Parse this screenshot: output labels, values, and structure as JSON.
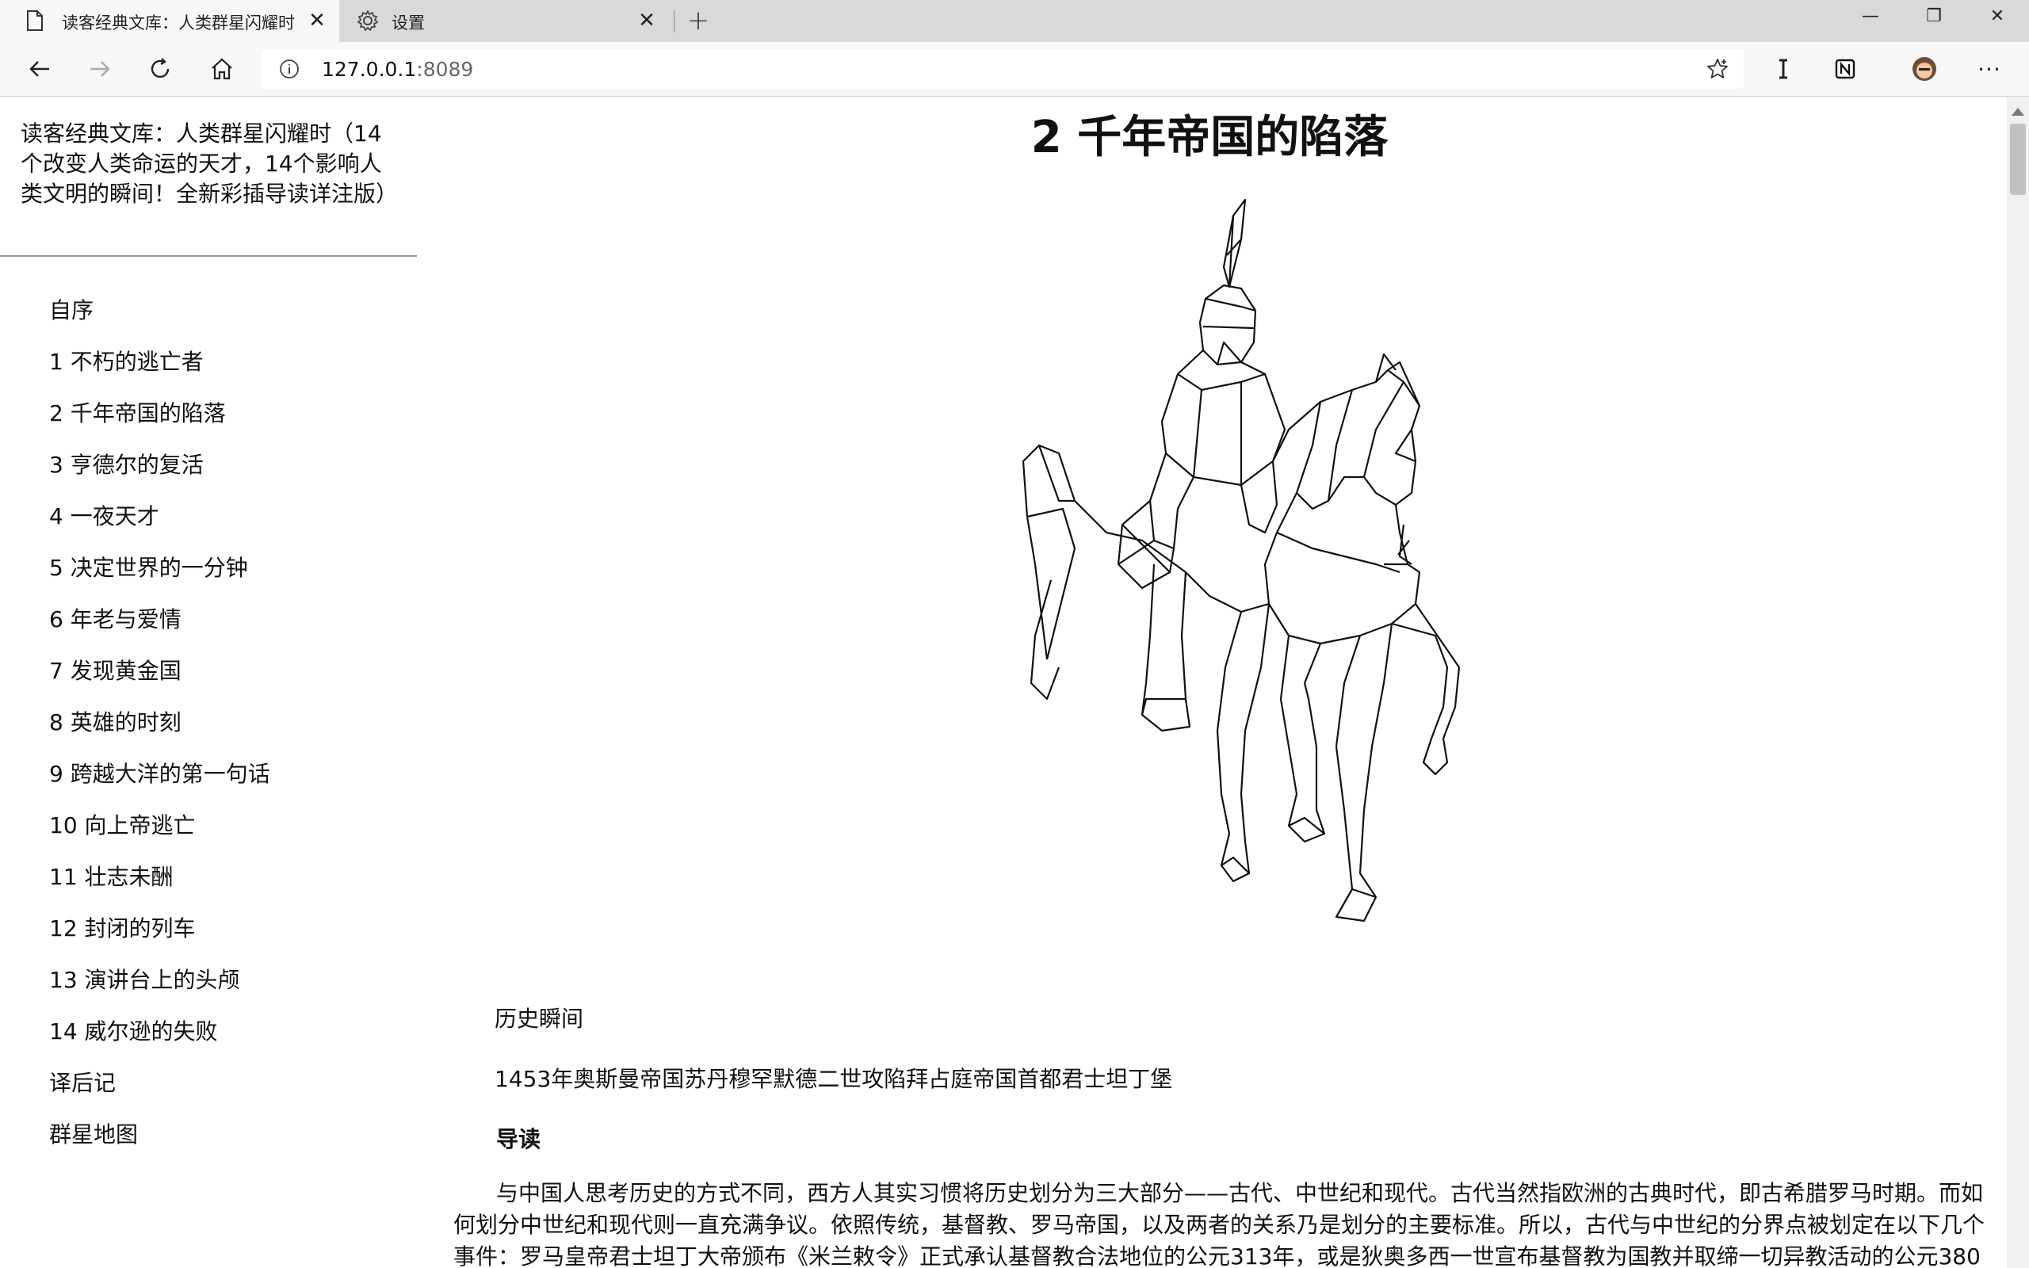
{
  "browser": {
    "tabs": [
      {
        "label": "读客经典文库：人类群星闪耀时",
        "icon": "page-icon",
        "active": true,
        "close": "✕"
      },
      {
        "label": "设置",
        "icon": "gear-icon",
        "active": false,
        "close": "✕"
      }
    ],
    "new_tab": "+",
    "window_controls": {
      "minimize": "—",
      "maximize": "❐",
      "close": "✕"
    },
    "address": {
      "host": "127.0.0.1",
      "port": ":8089"
    },
    "extensions": [
      "text-cursor-icon",
      "notion-icon",
      "avatar-icon",
      "more-icon"
    ],
    "more_label": "···"
  },
  "sidebar": {
    "book_title": "读客经典文库：人类群星闪耀时（14个改变人类命运的天才，14个影响人类文明的瞬间！全新彩插导读详注版）",
    "items": [
      "自序",
      "1 不朽的逃亡者",
      "2 千年帝国的陷落",
      "3 亨德尔的复活",
      "4 一夜天才",
      "5 决定世界的一分钟",
      "6 年老与爱情",
      "7 发现黄金国",
      "8 英雄的时刻",
      "9 跨越大洋的第一句话",
      "10 向上帝逃亡",
      "11 壮志未酬",
      "12 封闭的列车",
      "13 演讲台上的头颅",
      "14 威尔逊的失败",
      "译后记",
      "群星地图"
    ]
  },
  "content": {
    "chapter_title": "2 千年帝国的陷落",
    "illustration": "knight-on-horse-line-art",
    "moment_label": "历史瞬间",
    "event": "1453年奥斯曼帝国苏丹穆罕默德二世攻陷拜占庭帝国首都君士坦丁堡",
    "guide_label": "导读",
    "body": "与中国人思考历史的方式不同，西方人其实习惯将历史划分为三大部分——古代、中世纪和现代。古代当然指欧洲的古典时代，即古希腊罗马时期。而如何划分中世纪和现代则一直充满争议。依照传统，基督教、罗马帝国，以及两者的关系乃是划分的主要标准。所以，古代与中世纪的分界点被划定在以下几个事件：罗马皇帝君士坦丁大帝颁布《米兰敕令》正式承认基督教合法地位的公元313年，或是狄奥多西一世宣布基督教为国教并取缔一切异教活动的公元380"
  }
}
